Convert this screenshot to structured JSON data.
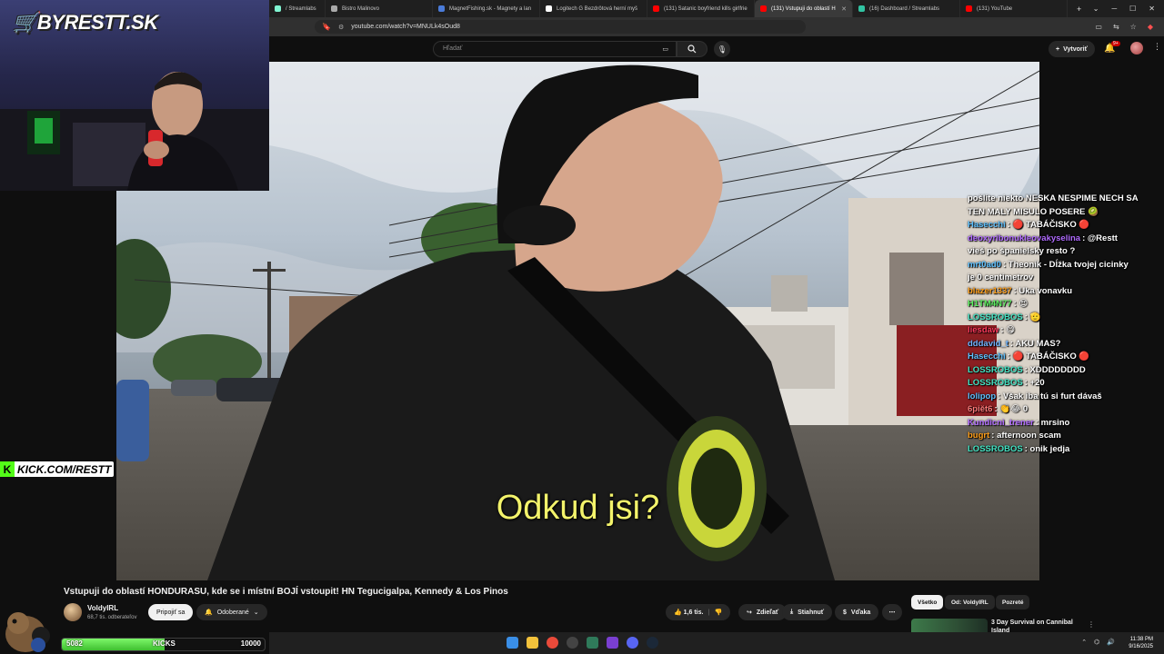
{
  "browser": {
    "tabs": [
      {
        "label": "/ Streamlabs",
        "color": "#80f5d2"
      },
      {
        "label": "Bistro Malinovo",
        "color": "#aaaaaa"
      },
      {
        "label": "MagnetFishing.sk - Magnety a lan",
        "color": "#4a7bd8"
      },
      {
        "label": "Logitech G Bezdrôtová herní myš",
        "color": "#ffffff"
      },
      {
        "label": "(131) Satanic boyfriend kills girlfrie",
        "color": "#ff0000"
      },
      {
        "label": "(131) Vstupuji do oblastí H",
        "color": "#ff0000",
        "active": true
      },
      {
        "label": "(16) Dashboard / Streamlabs",
        "color": "#31c3a2"
      },
      {
        "label": "(131) YouTube",
        "color": "#ff0000"
      }
    ],
    "new_tab": "+",
    "url": "youtube.com/watch?v=MNULk4sOud8"
  },
  "youtube": {
    "search_placeholder": "Hľadať",
    "create_label": "Vytvoriť",
    "notif_count": "9+",
    "video_title": "Vstupuji do oblastí HONDURASU, kde se i místní BOJÍ vstoupit! HN Tegucigalpa, Kennedy & Los Pinos",
    "channel_name": "VoldyIRL",
    "channel_subs": "68,7 tis. odberateľov",
    "join_label": "Pripojiť sa",
    "subscribe_label": "Odoberané",
    "likes": "1,6 tis.",
    "share_label": "Zdieľať",
    "download_label": "Stiahnuť",
    "thanks_label": "Vďaka",
    "chips": [
      "Všetko",
      "Od: VoldyIRL",
      "Pozreté"
    ],
    "rec_title": "3 Day Survival on Cannibal Island"
  },
  "video": {
    "subtitle": "Odkud jsi?"
  },
  "stream": {
    "logo_text": "BYRESTT.SK",
    "kick_text": "KICK.COM/RESTT",
    "kicks_current": "5082",
    "kicks_label": "KICKS",
    "kicks_goal": "10000",
    "kicks_progress": 0.5082
  },
  "chat": [
    {
      "user": "",
      "user_color": "#ffffff",
      "msg": "pošlite niekto NESKA NESPIME NECH SA"
    },
    {
      "user": "",
      "user_color": "#ffffff",
      "msg": "TEN MALY MISULO POSERE 🥝"
    },
    {
      "user": "Hasecchi",
      "user_color": "#5ec1ff",
      "msg": "🔴 TABÁČISKO 🔴"
    },
    {
      "user": "deoxyribonukleovakyselina",
      "user_color": "#b06bff",
      "msg": "@Restt"
    },
    {
      "user": "",
      "user_color": "#ffffff",
      "msg": "vieš po španielsky resto ?"
    },
    {
      "user": "mrt0ad0",
      "user_color": "#5ec1ff",
      "msg": "Theonik - Dĺžka tvojej cicinky"
    },
    {
      "user": "",
      "user_color": "#ffffff",
      "msg": "je 0 centimetrov"
    },
    {
      "user": "blazer1337",
      "user_color": "#ff9f1a",
      "msg": "Uka vonavku"
    },
    {
      "user": "H1TM4N77",
      "user_color": "#5df060",
      "msg": "😍"
    },
    {
      "user": "LOSSROBOS",
      "user_color": "#43e3c3",
      "msg": "🫡"
    },
    {
      "user": "liesdaw",
      "user_color": "#ff3a5c",
      "msg": "😋"
    },
    {
      "user": "dddavid_t",
      "user_color": "#6fb4ff",
      "msg": "AKU MAS?"
    },
    {
      "user": "Hasecchi",
      "user_color": "#5ec1ff",
      "msg": "🔴 TABÁČISKO 🔴"
    },
    {
      "user": "LOSSROBOS",
      "user_color": "#43e3c3",
      "msg": "XDDDDDDDD"
    },
    {
      "user": "LOSSROBOS",
      "user_color": "#43e3c3",
      "msg": "+20"
    },
    {
      "user": "lolipop",
      "user_color": "#5ec1ff",
      "msg": "Však iba tú si furt dávaš"
    },
    {
      "user": "6piět6",
      "user_color": "#ff7a7a",
      "msg": "👏😂 0"
    },
    {
      "user": "Kundicni_trener",
      "user_color": "#b06bff",
      "msg": "mrsino"
    },
    {
      "user": "bugrt",
      "user_color": "#ff9f1a",
      "msg": "afternoon scam"
    },
    {
      "user": "LOSSROBOS",
      "user_color": "#43e3c3",
      "msg": "onik jedja"
    }
  ],
  "taskbar": {
    "time": "11:38 PM",
    "date": "9/16/2025"
  }
}
